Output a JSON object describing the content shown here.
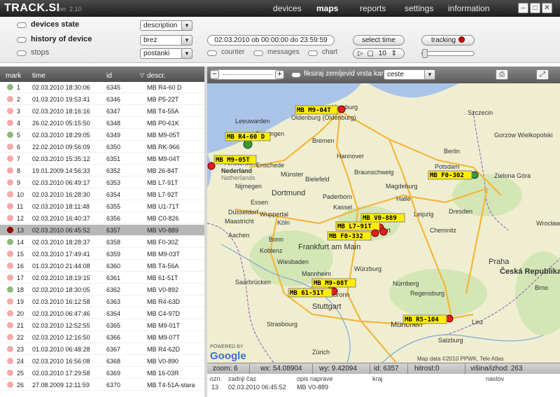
{
  "app": {
    "logo": "TRACK.SI",
    "version": "ver. 2.10",
    "nav": [
      "devices",
      "maps",
      "reports",
      "settings",
      "information"
    ],
    "nav_active": "maps"
  },
  "window_controls": [
    "minimize",
    "maximize",
    "close"
  ],
  "controls": {
    "devices_state": {
      "label": "devices state",
      "dropdown": "description"
    },
    "history": {
      "label": "history of device",
      "dropdown": "brez",
      "period": "02.03.2010 ob 00:00:00 do 23:59:59",
      "select_time": "select time",
      "tracking": "tracking"
    },
    "stops": {
      "label": "stops",
      "dropdown": "postanki",
      "counter": "counter",
      "messages": "messages",
      "chart": "chart",
      "speed": "10"
    }
  },
  "list": {
    "columns": [
      "mark",
      "time",
      "id",
      "descr."
    ],
    "rows": [
      {
        "n": "1",
        "time": "02.03.2010 18:30:06",
        "id": "6345",
        "descr": "MB R4-60 D",
        "status": "green"
      },
      {
        "n": "2",
        "time": "01.03.2010 19:53:41",
        "id": "6346",
        "descr": "MB P5-22T",
        "status": "pink"
      },
      {
        "n": "3",
        "time": "02.03.2010 18:16:16",
        "id": "6347",
        "descr": "MB T4-55A",
        "status": "pink"
      },
      {
        "n": "4",
        "time": "26.02.2010 05:15:50",
        "id": "6348",
        "descr": "MB P0-61K",
        "status": "pink"
      },
      {
        "n": "5",
        "time": "02.03.2010 18:29:05",
        "id": "6349",
        "descr": "MB M9-05T",
        "status": "green"
      },
      {
        "n": "6",
        "time": "22.02.2010 09:56:09",
        "id": "6350",
        "descr": "MB RK-966",
        "status": "pink"
      },
      {
        "n": "7",
        "time": "02.03.2010 15:35:12",
        "id": "6351",
        "descr": "MB M9-04T",
        "status": "pink"
      },
      {
        "n": "8",
        "time": "19.01.2009 14:56:33",
        "id": "6352",
        "descr": "MB 26-84T",
        "status": "pink"
      },
      {
        "n": "9",
        "time": "02.03.2010 06:49:17",
        "id": "6353",
        "descr": "MB L7-91T",
        "status": "pink"
      },
      {
        "n": "10",
        "time": "02.03.2010 16:28:30",
        "id": "6354",
        "descr": "MB L7-92T",
        "status": "pink"
      },
      {
        "n": "11",
        "time": "02.03.2010 18:11:48",
        "id": "6355",
        "descr": "MB U1-71T",
        "status": "pink"
      },
      {
        "n": "12",
        "time": "02.03.2010 16:40:37",
        "id": "6356",
        "descr": "MB C0-826",
        "status": "pink"
      },
      {
        "n": "13",
        "time": "02.03.2010 06:45:52",
        "id": "6357",
        "descr": "MB V0-889",
        "status": "red",
        "selected": true
      },
      {
        "n": "14",
        "time": "02.03.2010 18:28:37",
        "id": "6358",
        "descr": "MB F0-30Z",
        "status": "green"
      },
      {
        "n": "15",
        "time": "02.03.2010 17:49:41",
        "id": "6359",
        "descr": "MB M9-03T",
        "status": "pink"
      },
      {
        "n": "16",
        "time": "01.03.2010 21:44:08",
        "id": "6360",
        "descr": "MB T4-56A",
        "status": "pink"
      },
      {
        "n": "17",
        "time": "02.03.2010 18:19:15",
        "id": "6361",
        "descr": "MB 61-51T",
        "status": "pink"
      },
      {
        "n": "18",
        "time": "02.03.2010 18:30:05",
        "id": "6362",
        "descr": "MB V0-892",
        "status": "green"
      },
      {
        "n": "19",
        "time": "02.03.2010 16:12:58",
        "id": "6363",
        "descr": "MB R4-63D",
        "status": "pink"
      },
      {
        "n": "20",
        "time": "02.03.2010 06:47:46",
        "id": "6364",
        "descr": "MB C4-97D",
        "status": "pink"
      },
      {
        "n": "21",
        "time": "02.03.2010 12:52:55",
        "id": "6365",
        "descr": "MB M9-01T",
        "status": "pink"
      },
      {
        "n": "22",
        "time": "02.03.2010 12:16:50",
        "id": "6366",
        "descr": "MB M9-07T",
        "status": "pink"
      },
      {
        "n": "23",
        "time": "01.03.2010 06:48:28",
        "id": "6367",
        "descr": "MB R4-62D",
        "status": "pink"
      },
      {
        "n": "24",
        "time": "02.03.2010 16:56:08",
        "id": "6368",
        "descr": "MB V0-890",
        "status": "pink"
      },
      {
        "n": "25",
        "time": "02.03.2010 17:29:58",
        "id": "6369",
        "descr": "MB 16-03R",
        "status": "pink"
      },
      {
        "n": "26",
        "time": "27.08.2009 12:11:59",
        "id": "6370",
        "descr": "MB T4-51A-stara",
        "status": "pink"
      }
    ]
  },
  "map": {
    "toolbar": {
      "layer_toggle": "fiksiraj zemljevid vrsta karte",
      "map_type": "ceste"
    },
    "markers": [
      {
        "label": "MB M9-04T",
        "status": "red"
      },
      {
        "label": "MB R4-60 D",
        "status": "green"
      },
      {
        "label": "MB M9-05T",
        "status": "red"
      },
      {
        "label": "MB F0-302",
        "status": "green"
      },
      {
        "label": "MB V0-889",
        "status": "red"
      },
      {
        "label": "MB L7-91T",
        "status": "red"
      },
      {
        "label": "MB F0-332",
        "status": "red"
      },
      {
        "label": "MB M9-08T",
        "status": "red"
      },
      {
        "label": "MB 61-51T",
        "status": "red"
      },
      {
        "label": "MB R5-104",
        "status": "red"
      }
    ],
    "cities": [
      "Hamburg",
      "Szczecin",
      "Oldenburg (Oldenburg)",
      "Bremen",
      "Leeuwarden",
      "Groningen",
      "Berlin",
      "Gorzów Wielkopolski",
      "Amsterdam",
      "Nederland",
      "Netherlands",
      "Hannover",
      "Braunschweig",
      "Potsdam",
      "Zielona Góra",
      "Enschede",
      "Münster",
      "Magdeburg",
      "Nijmegen",
      "Dortmund",
      "Bielefeld",
      "Paderborn",
      "Halle",
      "Leipzig",
      "Dresden",
      "Essen",
      "Düsseldorf",
      "Wuppertal",
      "Kassel",
      "Maastricht",
      "Köln",
      "Bonn",
      "Aachen",
      "Erfurt",
      "Chemnitz",
      "Wrocław",
      "Koblenz",
      "Frankfurt am Main",
      "Wiesbaden",
      "Würzburg",
      "Mannheim",
      "Nürnberg",
      "Saarbrücken",
      "Heilbronn",
      "Stuttgart",
      "Regensburg",
      "Strasbourg",
      "München",
      "Praha",
      "Česká Republika",
      "Brno",
      "Zürich",
      "Salzburg",
      "Linz"
    ],
    "attribution": "Map data ©2010 PPWK, Tele Atlas",
    "google": "Google",
    "powered": "POWERED BY"
  },
  "status": {
    "zoom": "zoom: 6",
    "wx": "wx: 54.08904",
    "wy": "wy: 9.42094",
    "id": "id: 6357",
    "speed": "hitrost:0",
    "alt": "višina/izhod: 263"
  },
  "details": {
    "headers": [
      "ozn.",
      "zadnji čas",
      "opis naprave",
      "kraj",
      "naslov"
    ],
    "values": [
      "13",
      "02.03.2010 06:45:52",
      "MB V0-889",
      "",
      ""
    ]
  },
  "colors": {
    "topbar": "#2f2f2f",
    "marker_label_bg": "#ffee00",
    "marker_red": "#e02020",
    "marker_green": "#3a9a2a",
    "selected_row": "#b7b7b7"
  }
}
